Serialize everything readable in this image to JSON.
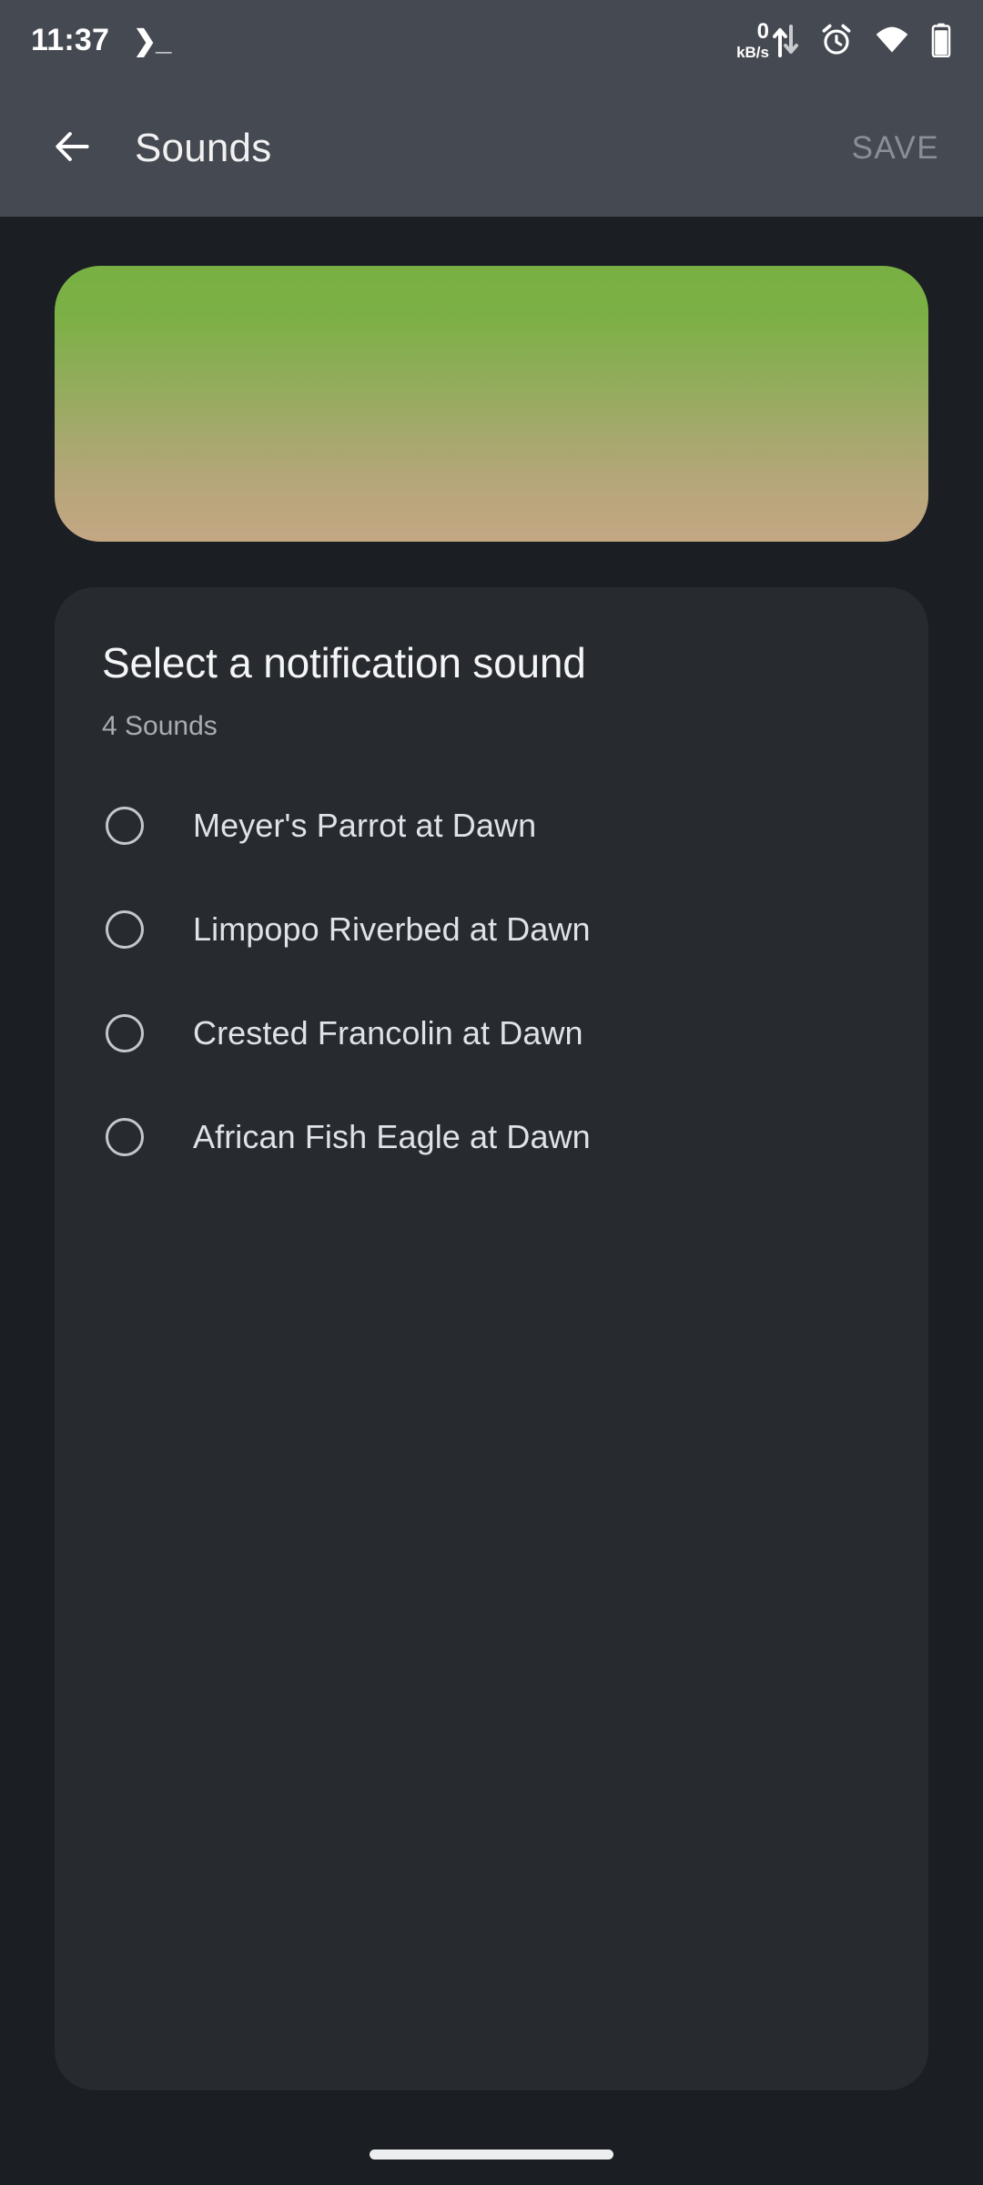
{
  "status_bar": {
    "time": "11:37",
    "terminal_icon": "terminal-icon",
    "network_speed_value": "0",
    "network_speed_unit": "kB/s",
    "icons": [
      "data-transfer-arrows-icon",
      "alarm-clock-icon",
      "wifi-icon",
      "battery-icon"
    ],
    "background_color": "#454951"
  },
  "app_bar": {
    "back_icon": "back-arrow-icon",
    "title": "Sounds",
    "save_label": "SAVE",
    "save_enabled": false,
    "save_color": "#8a8e95",
    "background_color": "#454951"
  },
  "banner": {
    "gradient_top_color": "#78b043",
    "gradient_bottom_color": "#c3a783"
  },
  "card": {
    "title": "Select a notification sound",
    "subtitle": "4 Sounds",
    "background_color": "#272a2f",
    "sounds": [
      {
        "label": "Meyer's Parrot at Dawn",
        "selected": false
      },
      {
        "label": "Limpopo Riverbed at Dawn",
        "selected": false
      },
      {
        "label": "Crested Francolin at Dawn",
        "selected": false
      },
      {
        "label": "African Fish Eagle at Dawn",
        "selected": false
      }
    ]
  },
  "page": {
    "background_color": "#1b1e23",
    "gesture_bar_color": "#eceef0"
  }
}
